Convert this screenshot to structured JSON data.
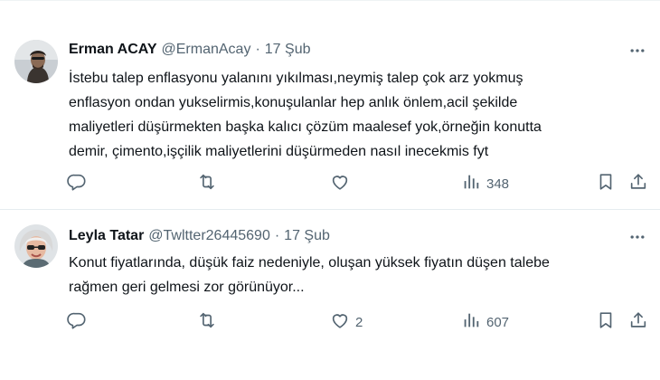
{
  "tweets": [
    {
      "name": "Erman ACAY",
      "handle": "@ErmanAcay",
      "separator": "·",
      "date": "17 Şub",
      "text_lines": [
        "İstebu talep enflasyonu yalanını yıkılması,neymiş talep çok arz yokmuş",
        "enflasyon ondan yukselirmis,konuşulanlar hep anlık önlem,acil şekilde",
        "maliyetleri düşürmekten başka kalıcı çözüm maalesef yok,örneğin konutta",
        "demir, çimento,işçilik maliyetlerini düşürmeden nasıl inecekmis fyt"
      ],
      "replies": "",
      "retweets": "",
      "likes": "",
      "views": "348"
    },
    {
      "name": "Leyla Tatar",
      "handle": "@Twltter26445690",
      "separator": "·",
      "date": "17 Şub",
      "text_lines": [
        "Konut fiyatlarında, düşük faiz nedeniyle, oluşan yüksek fiyatın düşen talebe",
        "rağmen geri gelmesi zor görünüyor..."
      ],
      "replies": "",
      "retweets": "",
      "likes": "2",
      "views": "607"
    }
  ],
  "icons": {
    "reply": "reply-icon",
    "retweet": "retweet-icon",
    "like": "heart-icon",
    "views": "views-icon",
    "bookmark": "bookmark-icon",
    "share": "share-icon",
    "more": "more-icon"
  },
  "colors": {
    "text": "#0f1419",
    "secondary": "#536471",
    "divider": "#e6ecf0"
  }
}
